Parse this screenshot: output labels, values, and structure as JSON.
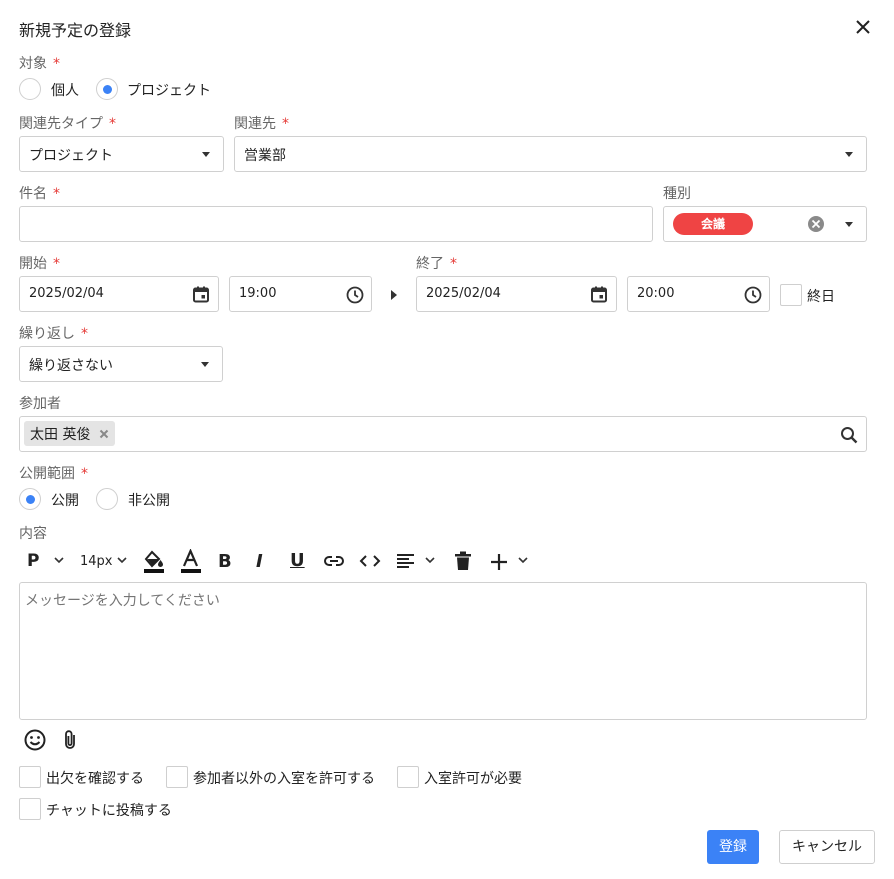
{
  "dialog": {
    "title": "新規予定の登録",
    "target": {
      "label": "対象",
      "required_mark": "*",
      "options": [
        "個人",
        "プロジェクト"
      ],
      "selected": "プロジェクト"
    },
    "related_type": {
      "label": "関連先タイプ",
      "required_mark": "*",
      "value": "プロジェクト"
    },
    "related": {
      "label": "関連先",
      "required_mark": "*",
      "value": "営業部"
    },
    "subject": {
      "label": "件名",
      "required_mark": "*",
      "value": ""
    },
    "category": {
      "label": "種別",
      "value": "会議",
      "color": "#ef4444"
    },
    "start": {
      "label": "開始",
      "required_mark": "*",
      "date": "2025/02/04",
      "time": "19:00"
    },
    "end": {
      "label": "終了",
      "required_mark": "*",
      "date": "2025/02/04",
      "time": "20:00"
    },
    "all_day": {
      "label": "終日",
      "checked": false
    },
    "repeat": {
      "label": "繰り返し",
      "required_mark": "*",
      "value": "繰り返さない"
    },
    "participants": {
      "label": "参加者",
      "items": [
        "太田 英俊"
      ]
    },
    "visibility": {
      "label": "公開範囲",
      "required_mark": "*",
      "options": [
        "公開",
        "非公開"
      ],
      "selected": "公開"
    },
    "content": {
      "label": "内容",
      "placeholder": "メッセージを入力してください",
      "toolbar": {
        "paragraph": "P",
        "font_size": "14px",
        "bold": "B",
        "italic": "I",
        "underline": "U"
      }
    },
    "options": [
      {
        "label": "出欠を確認する",
        "checked": false
      },
      {
        "label": "参加者以外の入室を許可する",
        "checked": false
      },
      {
        "label": "入室許可が必要",
        "checked": false
      },
      {
        "label": "チャットに投稿する",
        "checked": false
      }
    ],
    "buttons": {
      "submit": "登録",
      "cancel": "キャンセル"
    },
    "colors": {
      "accent": "#3b82f6",
      "required": "#e53935",
      "category_tag": "#ef4444"
    }
  }
}
